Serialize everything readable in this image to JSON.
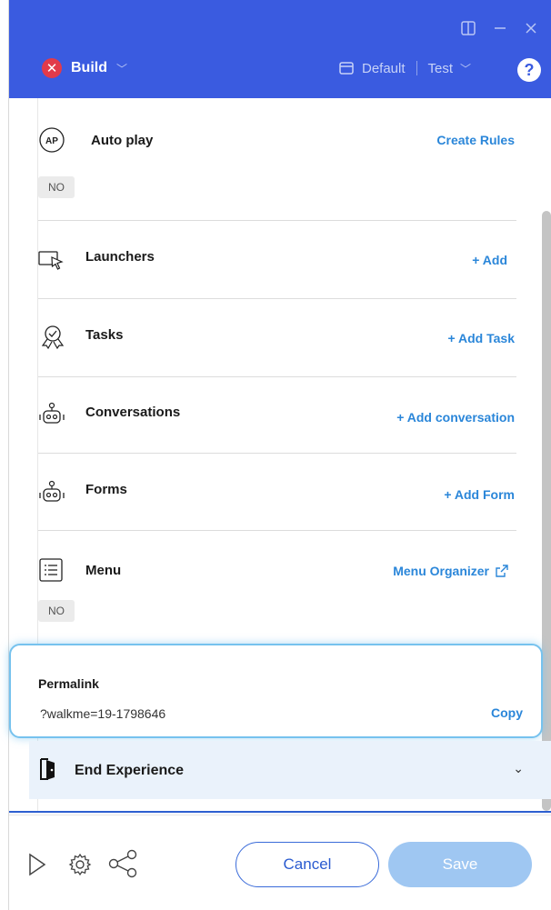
{
  "header": {
    "build_label": "Build",
    "env_default": "Default",
    "env_test": "Test",
    "help_label": "?"
  },
  "rows": {
    "autoplay": {
      "icon_text": "AP",
      "title": "Auto play",
      "action": "Create Rules",
      "badge": "NO"
    },
    "launchers": {
      "title": "Launchers",
      "action": "+ Add"
    },
    "tasks": {
      "title": "Tasks",
      "action": "+ Add Task"
    },
    "conversations": {
      "title": "Conversations",
      "action": "+ Add conversation"
    },
    "forms": {
      "title": "Forms",
      "action": "+ Add Form"
    },
    "menu": {
      "title": "Menu",
      "action": "Menu Organizer",
      "badge": "NO"
    }
  },
  "permalink": {
    "title": "Permalink",
    "value": "?walkme=19-1798646",
    "copy_label": "Copy"
  },
  "end_experience": {
    "title": "End Experience"
  },
  "footer": {
    "cancel_label": "Cancel",
    "save_label": "Save"
  },
  "colors": {
    "header_bg": "#3a5be0",
    "accent_link": "#2a86d9",
    "close_badge": "#e23a4a",
    "save_disabled": "#9fc7f2"
  }
}
